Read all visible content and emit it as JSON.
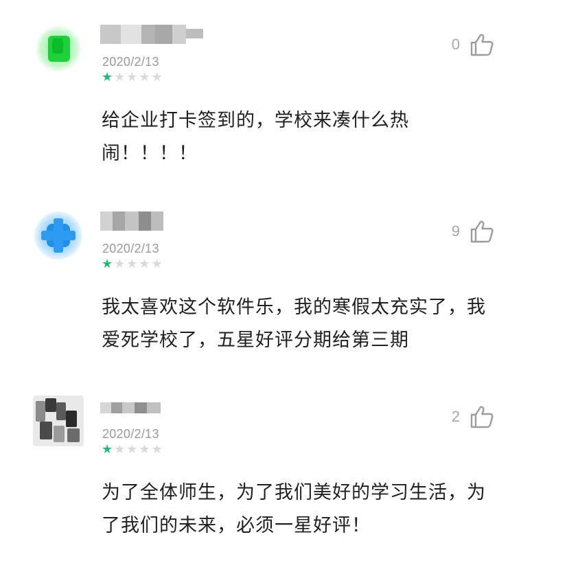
{
  "reviews": [
    {
      "date": "2020/2/13",
      "stars_filled": 1,
      "stars_total": 5,
      "likes": "0",
      "text_line1": "给企业打卡签到的，学校来凑什么热",
      "text_line2": "闹！！！！",
      "avatar_color": "#22cc44"
    },
    {
      "date": "2020/2/13",
      "stars_filled": 1,
      "stars_total": 5,
      "likes": "9",
      "text_line1": "我太喜欢这个软件乐，我的寒假太充实了，我",
      "text_line2": "爱死学校了，五星好评分期给第三期",
      "avatar_color": "#2f9bf0"
    },
    {
      "date": "2020/2/13",
      "stars_filled": 1,
      "stars_total": 5,
      "likes": "2",
      "text_line1": "为了全体师生，为了我们美好的学习生活，为",
      "text_line2": "了我们的未来，必须一星好评！",
      "avatar_color": "#555555"
    }
  ],
  "colors": {
    "star_on": "#1dbb75",
    "star_off": "#d9d9d9",
    "meta_gray": "#9a9a9a"
  },
  "icons": {
    "like": "thumbs-up-icon",
    "star": "star-icon"
  }
}
